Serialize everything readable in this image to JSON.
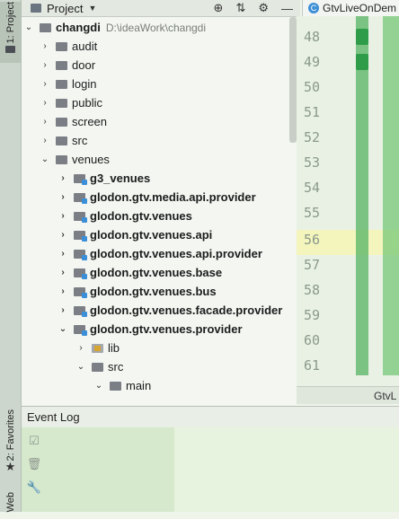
{
  "side_tabs": {
    "project": "1: Project",
    "favorites": "2: Favorites",
    "web": "Web"
  },
  "project_header": {
    "title": "Project",
    "caret": "▼",
    "tools": [
      "⊕",
      "⇅",
      "⚙",
      "—"
    ]
  },
  "editor": {
    "tab_label": "GtvLiveOnDem",
    "tab_icon": "C",
    "line_numbers": [
      "48",
      "49",
      "50",
      "51",
      "52",
      "53",
      "54",
      "55",
      "56",
      "57",
      "58",
      "59",
      "60",
      "61"
    ],
    "highlight_line": "56",
    "footer_text": "GtvL"
  },
  "tree": {
    "root": {
      "label": "changdi",
      "path": "D:\\ideaWork\\changdi"
    },
    "items": [
      {
        "label": "audit",
        "icon": "folder"
      },
      {
        "label": "door",
        "icon": "folder"
      },
      {
        "label": "login",
        "icon": "folder"
      },
      {
        "label": "public",
        "icon": "folder"
      },
      {
        "label": "screen",
        "icon": "folder"
      },
      {
        "label": "src",
        "icon": "folder"
      },
      {
        "label": "venues",
        "icon": "folder",
        "expanded": true
      },
      {
        "label": "g3_venues",
        "icon": "module-folder"
      },
      {
        "label": "glodon.gtv.media.api.provider",
        "icon": "module-folder"
      },
      {
        "label": "glodon.gtv.venues",
        "icon": "module-folder"
      },
      {
        "label": "glodon.gtv.venues.api",
        "icon": "module-folder"
      },
      {
        "label": "glodon.gtv.venues.api.provider",
        "icon": "module-folder"
      },
      {
        "label": "glodon.gtv.venues.base",
        "icon": "module-folder"
      },
      {
        "label": "glodon.gtv.venues.bus",
        "icon": "module-folder"
      },
      {
        "label": "glodon.gtv.venues.facade.provider",
        "icon": "module-folder"
      },
      {
        "label": "glodon.gtv.venues.provider",
        "icon": "module-folder",
        "expanded": true
      },
      {
        "label": "lib",
        "icon": "library-folder"
      },
      {
        "label": "src",
        "icon": "folder",
        "expanded": true
      },
      {
        "label": "main",
        "icon": "folder",
        "expanded": true
      }
    ]
  },
  "event_log": {
    "title": "Event Log"
  },
  "colors": {
    "module_badge": "#3b8fd8",
    "gutter_green": "#5fb86a",
    "line_highlight": "#f4f4bd"
  }
}
